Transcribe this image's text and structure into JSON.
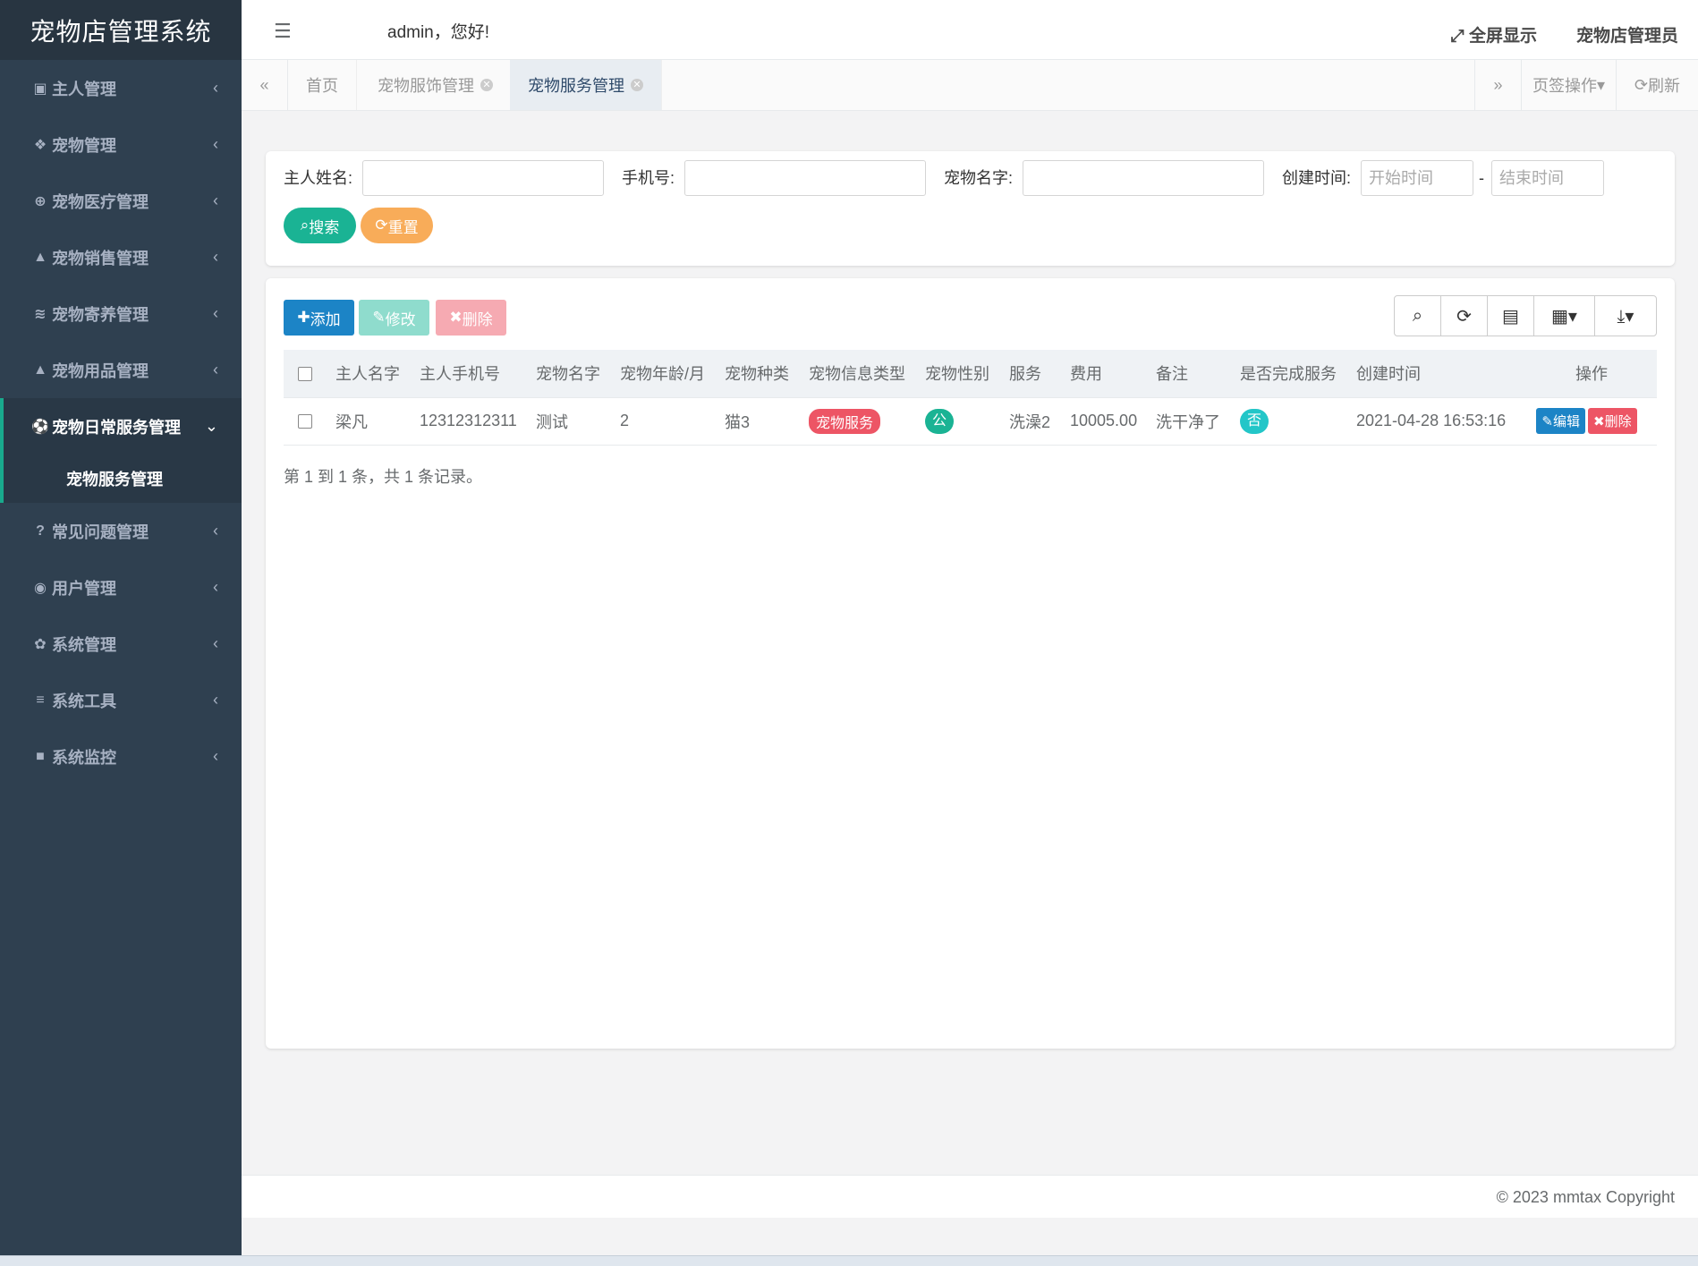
{
  "brand": "宠物店管理系统",
  "topbar": {
    "greeting": "admin，您好!",
    "fullscreen": "全屏显示",
    "user": "宠物店管理员"
  },
  "sidebar": {
    "items": [
      {
        "icon": "▣",
        "label": "主人管理"
      },
      {
        "icon": "❖",
        "label": "宠物管理"
      },
      {
        "icon": "⊕",
        "label": "宠物医疗管理"
      },
      {
        "icon": "▲",
        "label": "宠物销售管理"
      },
      {
        "icon": "≋",
        "label": "宠物寄养管理"
      },
      {
        "icon": "▲",
        "label": "宠物用品管理"
      },
      {
        "icon": "⚽",
        "label": "宠物日常服务管理"
      },
      {
        "icon": "?",
        "label": "常见问题管理"
      },
      {
        "icon": "◉",
        "label": "用户管理"
      },
      {
        "icon": "✿",
        "label": "系统管理"
      },
      {
        "icon": "≡",
        "label": "系统工具"
      },
      {
        "icon": "■",
        "label": "系统监控"
      }
    ],
    "active_sub": "宠物服务管理"
  },
  "tabs": {
    "items": [
      "首页",
      "宠物服饰管理",
      "宠物服务管理"
    ],
    "ops": "页签操作",
    "refresh": "刷新"
  },
  "search": {
    "owner_label": "主人姓名:",
    "phone_label": "手机号:",
    "petname_label": "宠物名字:",
    "created_label": "创建时间:",
    "start_placeholder": "开始时间",
    "end_placeholder": "结束时间",
    "dash": "-",
    "search_btn": "搜索",
    "reset_btn": "重置"
  },
  "toolbar": {
    "add": "添加",
    "edit": "修改",
    "delete": "删除"
  },
  "table": {
    "headers": [
      "主人名字",
      "主人手机号",
      "宠物名字",
      "宠物年龄/月",
      "宠物种类",
      "宠物信息类型",
      "宠物性别",
      "服务",
      "费用",
      "备注",
      "是否完成服务",
      "创建时间",
      "操作"
    ],
    "rows": [
      {
        "owner": "梁凡",
        "phone": "12312312311",
        "pet": "测试",
        "age": "2",
        "kind": "猫3",
        "info_type": "宠物服务",
        "gender": "公",
        "service": "洗澡2",
        "fee": "10005.00",
        "note": "洗干净了",
        "done": "否",
        "created": "2021-04-28 16:53:16",
        "edit": "编辑",
        "delete": "删除"
      }
    ]
  },
  "pager": "第 1 到 1 条，共 1 条记录。",
  "footer": "© 2023 mmtax Copyright",
  "colors": {
    "sidebar": "#2f4050",
    "accent": "#1ab394",
    "primary": "#1c84c6",
    "warning": "#f8ac59",
    "danger": "#ed5565",
    "info": "#23c6c8"
  }
}
